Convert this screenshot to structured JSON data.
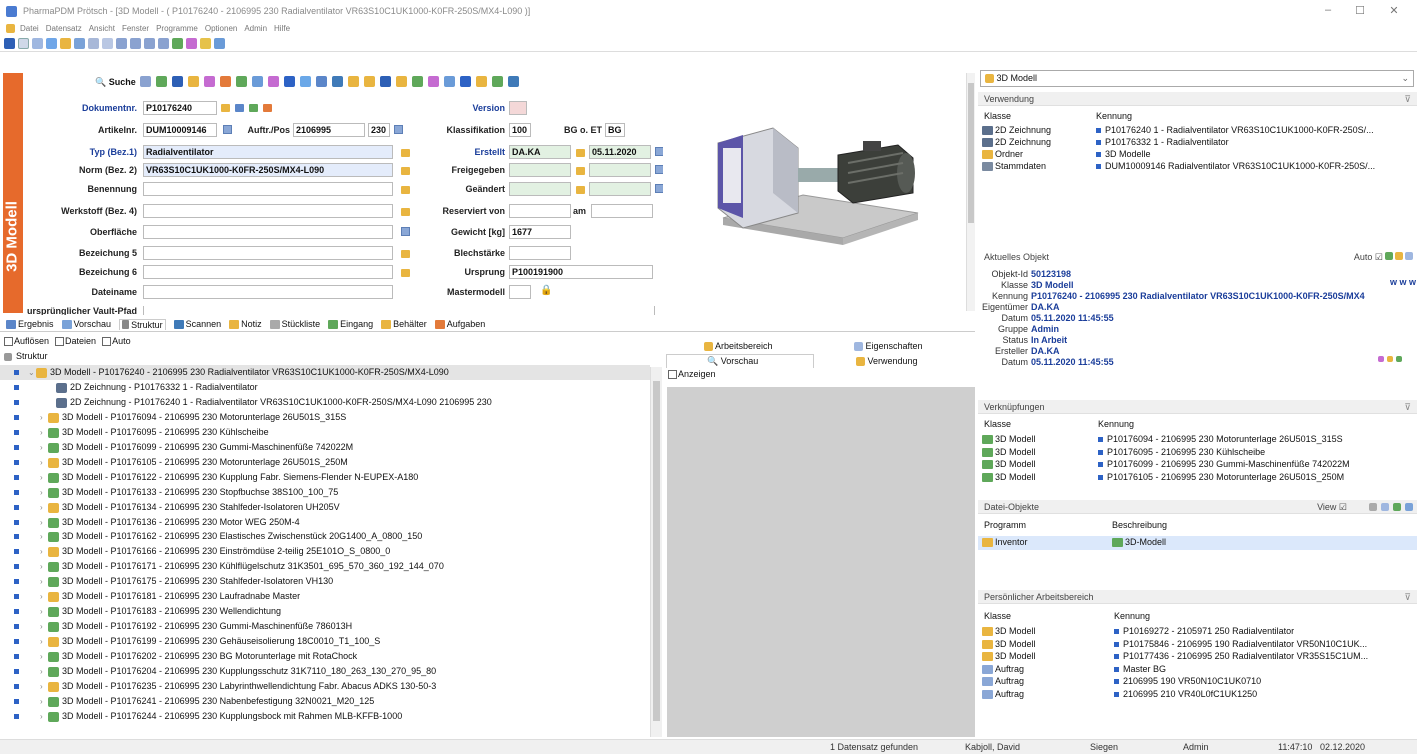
{
  "window": {
    "title": "PharmaPDM Prötsch - [3D Modell - ( P10176240 - 2106995 230 Radialventilator VR63S10C1UK1000-K0FR-250S/MX4-L090 )]"
  },
  "menu": [
    "Datei",
    "Datensatz",
    "Ansicht",
    "Fenster",
    "Programme",
    "Optionen",
    "Admin",
    "Hilfe"
  ],
  "vtab": "3D Modell",
  "form": {
    "search_label": "Suche",
    "dokumentnr_label": "Dokumentnr.",
    "dokumentnr": "P10176240",
    "version_label": "Version",
    "artikelnr_label": "Artikelnr.",
    "artikelnr": "DUM10009146",
    "auftrpos_label": "Auftr./Pos",
    "auftr": "2106995",
    "pos": "230",
    "klassifikation_label": "Klassifikation",
    "klassifikation": "100",
    "bgoet_label": "BG o. ET",
    "bgoet": "BG",
    "typ_label": "Typ (Bez.1)",
    "typ": "Radialventilator",
    "erstellt_label": "Erstellt",
    "erstellt_user": "DA.KA",
    "erstellt_date": "05.11.2020",
    "norm_label": "Norm (Bez. 2)",
    "norm": "VR63S10C1UK1000-K0FR-250S/MX4-L090",
    "freigegeben_label": "Freigegeben",
    "benennung_label": "Benennung",
    "geaendert_label": "Geändert",
    "werkstoff_label": "Werkstoff (Bez. 4)",
    "reserviert_label": "Reserviert von",
    "am_label": "am",
    "oberflaeche_label": "Oberfläche",
    "gewicht_label": "Gewicht [kg]",
    "gewicht": "1677",
    "bez5_label": "Bezeichung 5",
    "blechstaerke_label": "Blechstärke",
    "bez6_label": "Bezeichung 6",
    "ursprung_label": "Ursprung",
    "ursprung": "P100191900",
    "dateiname_label": "Dateiname",
    "mastermodell_label": "Mastermodell",
    "vault_label": "ursprünglicher Vault-Pfad"
  },
  "tabs": [
    "Ergebnis",
    "Vorschau",
    "Struktur",
    "Scannen",
    "Notiz",
    "Stückliste",
    "Eingang",
    "Behälter",
    "Aufgaben"
  ],
  "checks": [
    "Auflösen",
    "Dateien",
    "Auto"
  ],
  "tree": {
    "root_label": "Struktur",
    "items": [
      "3D Modell - P10176240 - 2106995 230 Radialventilator VR63S10C1UK1000-K0FR-250S/MX4-L090",
      "2D Zeichnung - P10176332 1 - Radialventilator",
      "2D Zeichnung - P10176240 1 - Radialventilator VR63S10C1UK1000-K0FR-250S/MX4-L090 2106995 230",
      "3D Modell - P10176094 - 2106995 230 Motorunterlage 26U501S_315S",
      "3D Modell - P10176095 - 2106995 230 Kühlscheibe",
      "3D Modell - P10176099 - 2106995 230 Gummi-Maschinenfüße 742022M",
      "3D Modell - P10176105 - 2106995 230 Motorunterlage 26U501S_250M",
      "3D Modell - P10176122 - 2106995 230 Kupplung Fabr. Siemens-Flender N-EUPEX-A180",
      "3D Modell - P10176133 - 2106995 230 Stopfbuchse 38S100_100_75",
      "3D Modell - P10176134 - 2106995 230 Stahlfeder-Isolatoren UH205V",
      "3D Modell - P10176136 - 2106995 230 Motor WEG 250M-4",
      "3D Modell - P10176162 - 2106995 230 Elastisches Zwischenstück 20G1400_A_0800_150",
      "3D Modell - P10176166 - 2106995 230 Einströmdüse 2-teilig 25E101O_S_0800_0",
      "3D Modell - P10176171 - 2106995 230 Kühlflügelschutz 31K3501_695_570_360_192_144_070",
      "3D Modell - P10176175 - 2106995 230 Stahlfeder-Isolatoren VH130",
      "3D Modell - P10176181 - 2106995 230 Laufradnabe Master",
      "3D Modell - P10176183 - 2106995 230 Wellendichtung",
      "3D Modell - P10176192 - 2106995 230 Gummi-Maschinenfüße 786013H",
      "3D Modell - P10176199 - 2106995 230 Gehäuseisolierung 18C0010_T1_100_S",
      "3D Modell - P10176202 - 2106995 230 BG Motorunterlage mit RotaChock",
      "3D Modell - P10176204 - 2106995 230 Kupplungsschutz 31K7110_180_263_130_270_95_80",
      "3D Modell - P10176235 - 2106995 230 Labyrinthwellendichtung Fabr. Abacus ADKS 130-50-3",
      "3D Modell - P10176241 - 2106995 230 Nabenbefestigung 32N0021_M20_125",
      "3D Modell - P10176244 - 2106995 230 Kupplungsbock mit Rahmen MLB-KFFB-1000"
    ]
  },
  "middle": {
    "arbeitsbereich": "Arbeitsbereich",
    "eigenschaften": "Eigenschaften",
    "vorschau": "Vorschau",
    "verwendung": "Verwendung",
    "anzeigen": "Anzeigen"
  },
  "right": {
    "combo": "3D Modell",
    "verwendung": {
      "title": "Verwendung",
      "col1": "Klasse",
      "col2": "Kennung",
      "rows": [
        {
          "klasse": "2D Zeichnung",
          "kennung": "P10176240 1 - Radialventilator VR63S10C1UK1000-K0FR-250S/..."
        },
        {
          "klasse": "2D Zeichnung",
          "kennung": "P10176332 1 - Radialventilator"
        },
        {
          "klasse": "Ordner",
          "kennung": "3D Modelle"
        },
        {
          "klasse": "Stammdaten",
          "kennung": "DUM10009146 Radialventilator VR63S10C1UK1000-K0FR-250S/..."
        }
      ]
    },
    "aktuelles": {
      "title": "Aktuelles Objekt",
      "auto": "Auto",
      "www": "w w w",
      "rows": [
        {
          "k": "Objekt-Id",
          "v": "50123198"
        },
        {
          "k": "Klasse",
          "v": "3D Modell"
        },
        {
          "k": "Kennung",
          "v": "P10176240 - 2106995 230 Radialventilator VR63S10C1UK1000-K0FR-250S/MX4"
        },
        {
          "k": "Eigentümer",
          "v": "DA.KA"
        },
        {
          "k": "Datum",
          "v": "05.11.2020 11:45:55"
        },
        {
          "k": "Gruppe",
          "v": "Admin"
        },
        {
          "k": "Status",
          "v": "In Arbeit"
        },
        {
          "k": "Ersteller",
          "v": "DA.KA"
        },
        {
          "k": "Datum",
          "v": "05.11.2020 11:45:55"
        }
      ]
    },
    "verknuepfungen": {
      "title": "Verknüpfungen",
      "col1": "Klasse",
      "col2": "Kennung",
      "rows": [
        {
          "klasse": "3D Modell",
          "kennung": "P10176094 - 2106995 230 Motorunterlage 26U501S_315S"
        },
        {
          "klasse": "3D Modell",
          "kennung": "P10176095 - 2106995 230 Kühlscheibe"
        },
        {
          "klasse": "3D Modell",
          "kennung": "P10176099 - 2106995 230 Gummi-Maschinenfüße 742022M"
        },
        {
          "klasse": "3D Modell",
          "kennung": "P10176105 - 2106995 230 Motorunterlage 26U501S_250M"
        }
      ]
    },
    "datei": {
      "title": "Datei-Objekte",
      "view": "View",
      "col1": "Programm",
      "col2": "Beschreibung",
      "programm": "Inventor",
      "beschreibung": "3D-Modell"
    },
    "persoenlich": {
      "title": "Persönlicher Arbeitsbereich",
      "col1": "Klasse",
      "col2": "Kennung",
      "rows": [
        {
          "klasse": "3D Modell",
          "kennung": "P10169272 - 2105971 250 Radialventilator"
        },
        {
          "klasse": "3D Modell",
          "kennung": "P10175846 - 2106995 190 Radialventilator VR50N10C1UK..."
        },
        {
          "klasse": "3D Modell",
          "kennung": "P10177436 - 2106995 250 Radialventilator VR35S15C1UM..."
        },
        {
          "klasse": "Auftrag",
          "kennung": "Master BG"
        },
        {
          "klasse": "Auftrag",
          "kennung": "2106995 190 VR50N10C1UK0710"
        },
        {
          "klasse": "Auftrag",
          "kennung": "2106995 210 VR40L0fC1UK1250"
        }
      ]
    }
  },
  "status": {
    "found": "1 Datensatz gefunden",
    "user": "Kabjoll, David",
    "site": "Siegen",
    "role": "Admin",
    "time": "11:47:10",
    "date": "02.12.2020"
  }
}
